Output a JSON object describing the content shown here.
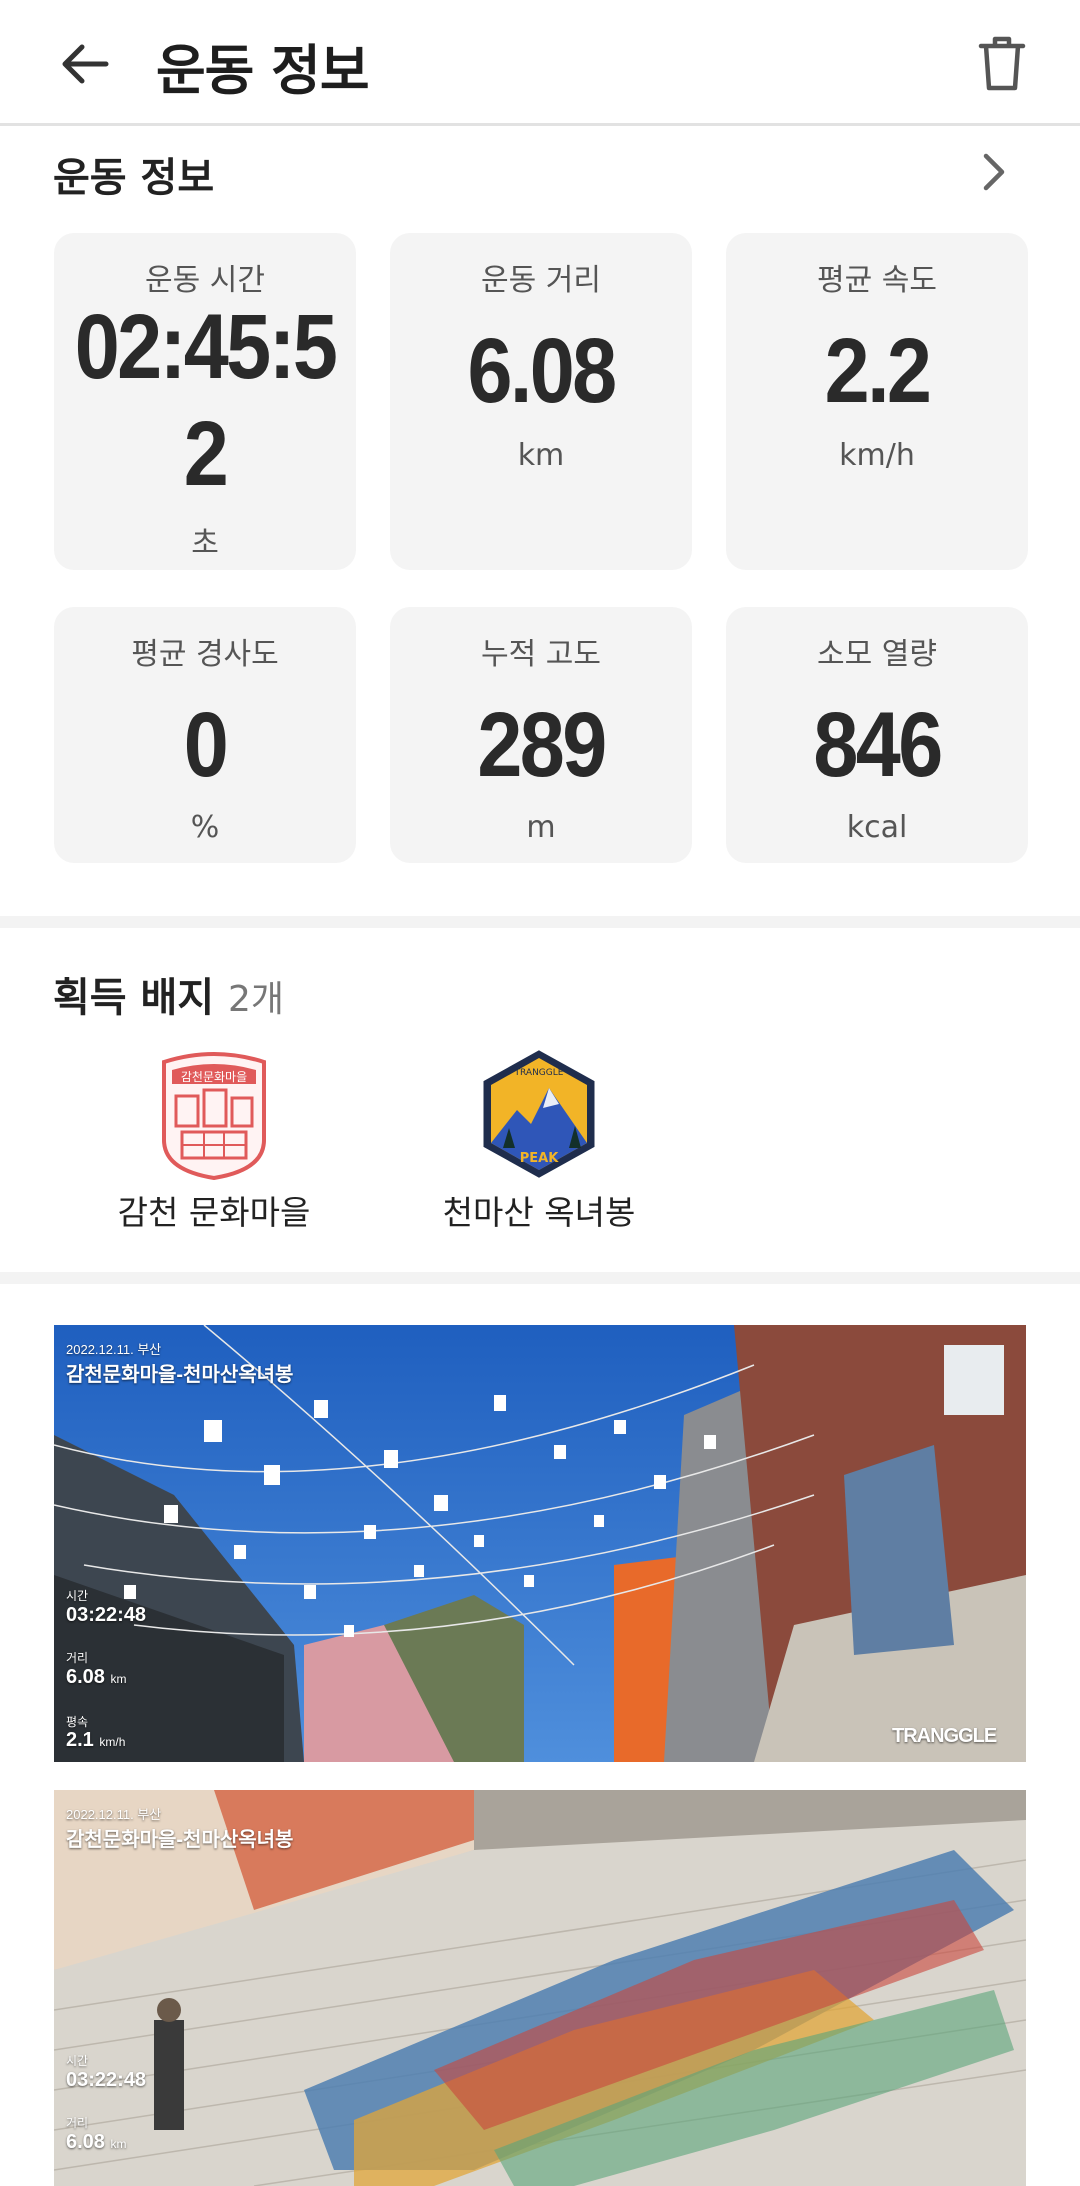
{
  "header": {
    "title": "운동 정보"
  },
  "workout": {
    "section_title": "운동 정보",
    "stats": [
      {
        "label": "운동 시간",
        "value_line1": "02:45:5",
        "value_line2": "2",
        "unit": "초"
      },
      {
        "label": "운동 거리",
        "value": "6.08",
        "unit": "km"
      },
      {
        "label": "평균 속도",
        "value": "2.2",
        "unit": "km/h"
      },
      {
        "label": "평균 경사도",
        "value": "0",
        "unit": "%"
      },
      {
        "label": "누적 고도",
        "value": "289",
        "unit": "m"
      },
      {
        "label": "소모 열량",
        "value": "846",
        "unit": "kcal"
      }
    ]
  },
  "badges": {
    "title": "획득 배지",
    "count": "2개",
    "items": [
      {
        "name": "감천 문화마을",
        "emblem_text": "감천문화마을",
        "icon": "gamcheon-stamp-badge-icon"
      },
      {
        "name": "천마산 옥녀봉",
        "emblem_text_top": "TRANGGLE",
        "emblem_text_bottom": "PEAK",
        "icon": "peak-mountain-badge-icon"
      }
    ]
  },
  "photos": [
    {
      "date": "2022.12.11. 부산",
      "route": "감천문화마을-천마산옥녀봉",
      "time_label": "시간",
      "time": "03:22:48",
      "dist_label": "거리",
      "dist": "6.08",
      "dist_unit": "km",
      "speed_label": "평속",
      "speed": "2.1",
      "speed_unit": "km/h",
      "watermark": "TRANGGLE"
    },
    {
      "date": "2022.12.11. 부산",
      "route": "감천문화마을-천마산옥녀봉",
      "time_label": "시간",
      "time": "03:22:48",
      "dist_label": "거리",
      "dist": "6.08",
      "dist_unit": "km"
    }
  ],
  "colors": {
    "card_bg": "#f4f4f4",
    "divider": "#f3f3f3",
    "sky": "#2f6fc8"
  }
}
